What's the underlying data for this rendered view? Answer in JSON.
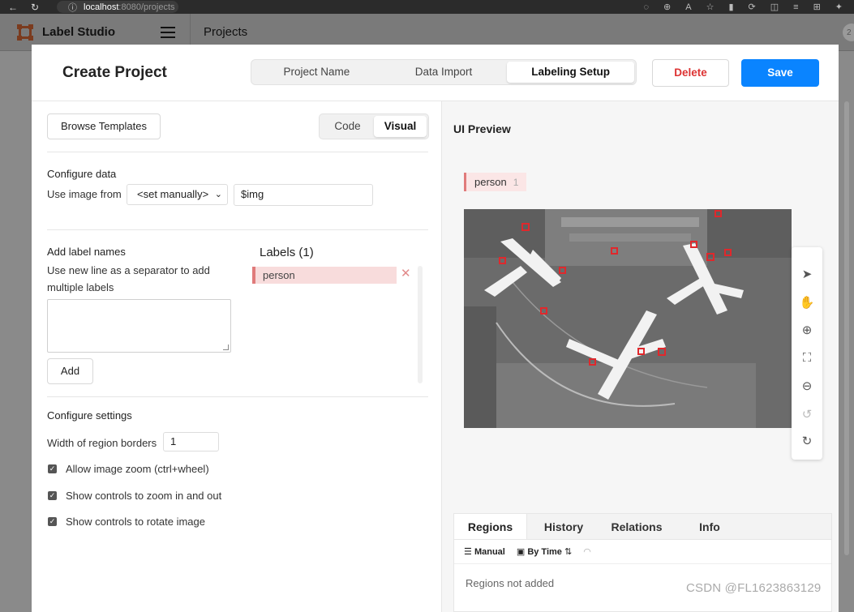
{
  "browser": {
    "url_host": "localhost",
    "url_rest": ":8080/projects",
    "info_icon": "info-icon"
  },
  "app": {
    "name": "Label Studio",
    "breadcrumb": "Projects",
    "avatar_initial": "2"
  },
  "modal": {
    "title": "Create Project",
    "steps": [
      "Project Name",
      "Data Import",
      "Labeling Setup"
    ],
    "active_step": "Labeling Setup",
    "delete_label": "Delete",
    "save_label": "Save"
  },
  "config": {
    "browse_templates": "Browse Templates",
    "modes": [
      "Code",
      "Visual"
    ],
    "active_mode": "Visual",
    "configure_data_title": "Configure data",
    "use_image_from": "Use image from",
    "source_select": "<set manually>",
    "variable_value": "$img",
    "add_label_title": "Add label names",
    "add_label_hint": "Use new line as a separator to add multiple labels",
    "labels_title": "Labels (1)",
    "labels": [
      {
        "name": "person",
        "color": "#e07b7b"
      }
    ],
    "add_button": "Add",
    "settings_title": "Configure settings",
    "border_width_label": "Width of region borders",
    "border_width_value": "1",
    "options": [
      {
        "label": "Allow image zoom (ctrl+wheel)",
        "checked": true
      },
      {
        "label": "Show controls to zoom in and out",
        "checked": true
      },
      {
        "label": "Show controls to rotate image",
        "checked": true
      }
    ]
  },
  "preview": {
    "title": "UI Preview",
    "chip_label": "person",
    "chip_hotkey": "1",
    "tools": [
      "pointer-icon",
      "hand-icon",
      "zoom-in-icon",
      "fit-icon",
      "zoom-out-icon",
      "rotate-left-icon",
      "rotate-right-icon"
    ],
    "tabs": [
      "Regions",
      "History",
      "Relations",
      "Info"
    ],
    "active_tab": "Regions",
    "sort_manual": "Manual",
    "sort_time": "By Time",
    "empty_text": "Regions not added"
  },
  "watermark": "CSDN @FL1623863129",
  "colors": {
    "accent": "#0a84ff",
    "danger": "#dd3333",
    "label": "#e07b7b"
  }
}
